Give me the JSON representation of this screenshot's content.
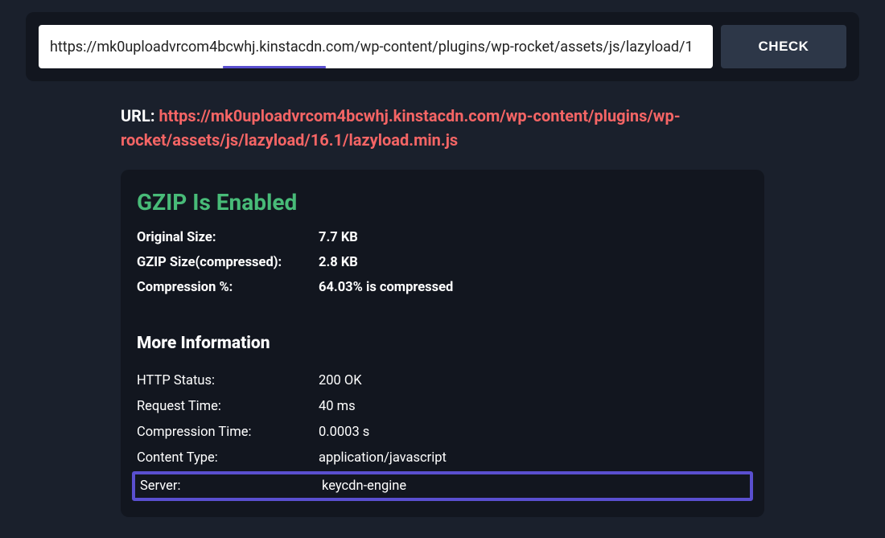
{
  "search": {
    "input_value": "https://mk0uploadvrcom4bcwhj.kinstacdn.com/wp-content/plugins/wp-rocket/assets/js/lazyload/1",
    "button_label": "CHECK"
  },
  "result": {
    "url_label": "URL:",
    "url_value": "https://mk0uploadvrcom4bcwhj.kinstacdn.com/wp-content/plugins/wp-rocket/assets/js/lazyload/16.1/lazyload.min.js",
    "gzip_heading": "GZIP Is Enabled",
    "summary": [
      {
        "label": "Original Size:",
        "value": "7.7 KB"
      },
      {
        "label": "GZIP Size(compressed):",
        "value": "2.8 KB"
      },
      {
        "label": "Compression %:",
        "value": "64.03% is compressed"
      }
    ],
    "more_heading": "More Information",
    "info": [
      {
        "label": "HTTP Status:",
        "value": "200 OK"
      },
      {
        "label": "Request Time:",
        "value": "40 ms"
      },
      {
        "label": "Compression Time:",
        "value": "0.0003 s"
      },
      {
        "label": "Content Type:",
        "value": "application/javascript"
      }
    ],
    "server_row": {
      "label": "Server:",
      "value": "keycdn-engine"
    }
  }
}
